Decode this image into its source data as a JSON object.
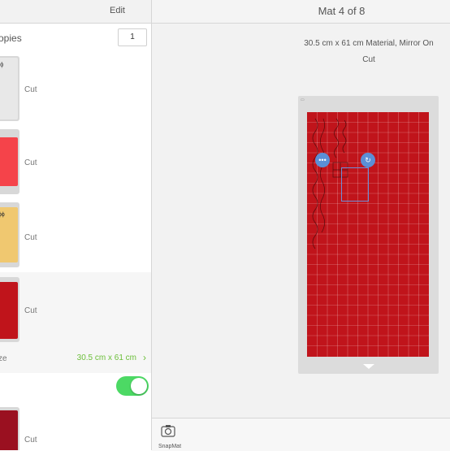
{
  "left_panel": {
    "edit_label": "Edit",
    "copies_label": "opies",
    "copies_value": "1",
    "mats": [
      {
        "label": "Cut",
        "color": "#e8e8e8"
      },
      {
        "label": "Cut",
        "color": "#f5434a"
      },
      {
        "label": "Cut",
        "color": "#f0c870"
      },
      {
        "label": "Cut",
        "color": "#c0141b"
      },
      {
        "label": "Cut",
        "color": "#9a1020"
      }
    ],
    "size_label": "ze",
    "size_value": "30.5 cm x 61 cm",
    "mirror_on": true
  },
  "right_panel": {
    "title": "Mat 4 of 8",
    "material_line1": "30.5 cm x 61 cm Material, Mirror On",
    "material_line2": "Cut",
    "mat_color": "#c0141b",
    "snapmat_label": "SnapMat"
  }
}
